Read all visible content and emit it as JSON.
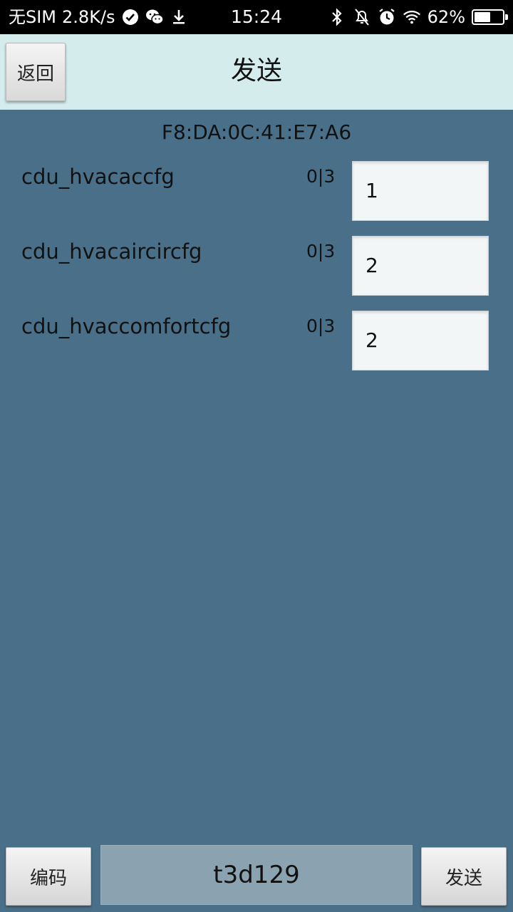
{
  "status_bar": {
    "carrier": "无SIM",
    "speed": "2.8K/s",
    "time": "15:24",
    "battery_percent": "62%",
    "battery_level": 0.62,
    "icons": [
      "check-circle-icon",
      "wechat-icon",
      "download-icon",
      "bluetooth-icon",
      "bell-off-icon",
      "alarm-icon",
      "wifi-icon",
      "battery-icon"
    ]
  },
  "header": {
    "back_label": "返回",
    "title": "发送"
  },
  "device_mac": "F8:DA:0C:41:E7:A6",
  "params": [
    {
      "name": "cdu_hvacaccfg",
      "range": "0|3",
      "value": "1"
    },
    {
      "name": "cdu_hvacaircircfg",
      "range": "0|3",
      "value": "2"
    },
    {
      "name": "cdu_hvaccomfortcfg",
      "range": "0|3",
      "value": "2"
    }
  ],
  "footer": {
    "encode_label": "编码",
    "code_value": "t3d129",
    "send_label": "发送"
  },
  "colors": {
    "background": "#4a7089",
    "header": "#d4ecec",
    "input": "#f3f6f6",
    "code_field": "#8ba3b0"
  }
}
